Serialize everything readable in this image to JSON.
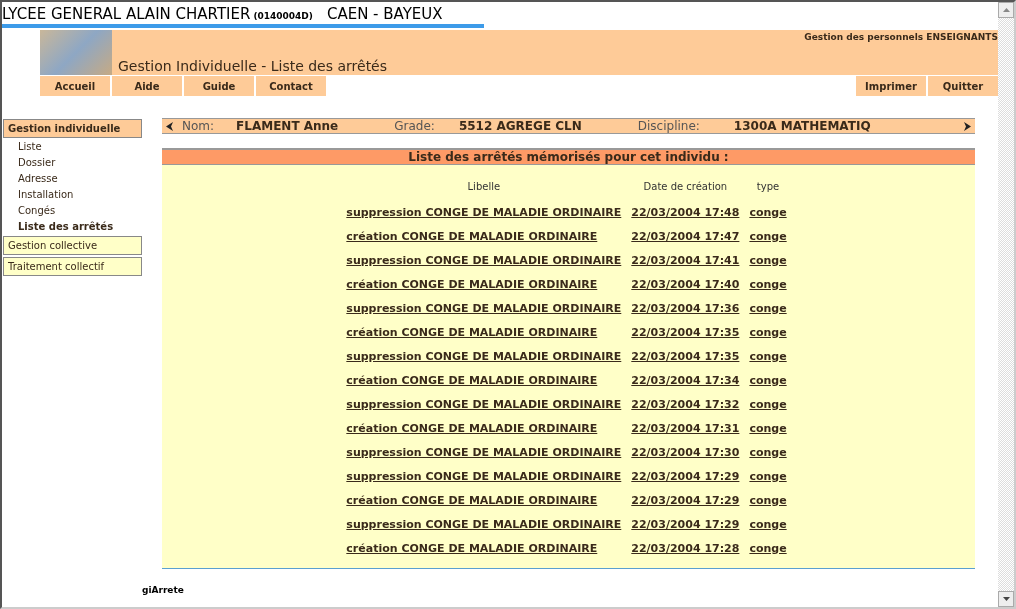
{
  "school": {
    "name": "LYCEE GENERAL ALAIN CHARTIER",
    "code": "(0140004D)",
    "city": "CAEN - BAYEUX"
  },
  "header": {
    "subtitle": "Gestion des personnels ENSEIGNANTS",
    "title": "Gestion Individuelle - Liste des arrêtés"
  },
  "nav_left": [
    "Accueil",
    "Aide",
    "Guide",
    "Contact"
  ],
  "nav_right": [
    "Imprimer",
    "Quitter"
  ],
  "sidebar": [
    {
      "label": "Gestion individuelle",
      "selected": true,
      "children": [
        {
          "label": "Liste",
          "selected": false
        },
        {
          "label": "Dossier",
          "selected": false
        },
        {
          "label": "Adresse",
          "selected": false
        },
        {
          "label": "Installation",
          "selected": false
        },
        {
          "label": "Congés",
          "selected": false
        },
        {
          "label": "Liste des arrêtés",
          "selected": true
        }
      ]
    },
    {
      "label": "Gestion collective",
      "selected": false
    },
    {
      "label": "Traitement collectif",
      "selected": false
    }
  ],
  "person": {
    "nom_label": "Nom:",
    "nom": "FLAMENT Anne",
    "grade_label": "Grade:",
    "grade": "5512 AGREGE CLN",
    "discipline_label": "Discipline:",
    "discipline": "1300A MATHEMATIQ"
  },
  "panel": {
    "title": "Liste des arrêtés mémorisés pour cet individu :",
    "columns": [
      "Libelle",
      "Date de création",
      "type"
    ],
    "rows": [
      [
        "suppression CONGE DE MALADIE ORDINAIRE",
        "22/03/2004 17:48",
        "conge"
      ],
      [
        "création CONGE DE MALADIE ORDINAIRE",
        "22/03/2004 17:47",
        "conge"
      ],
      [
        "suppression CONGE DE MALADIE ORDINAIRE",
        "22/03/2004 17:41",
        "conge"
      ],
      [
        "création CONGE DE MALADIE ORDINAIRE",
        "22/03/2004 17:40",
        "conge"
      ],
      [
        "suppression CONGE DE MALADIE ORDINAIRE",
        "22/03/2004 17:36",
        "conge"
      ],
      [
        "création CONGE DE MALADIE ORDINAIRE",
        "22/03/2004 17:35",
        "conge"
      ],
      [
        "suppression CONGE DE MALADIE ORDINAIRE",
        "22/03/2004 17:35",
        "conge"
      ],
      [
        "création CONGE DE MALADIE ORDINAIRE",
        "22/03/2004 17:34",
        "conge"
      ],
      [
        "suppression CONGE DE MALADIE ORDINAIRE",
        "22/03/2004 17:32",
        "conge"
      ],
      [
        "création CONGE DE MALADIE ORDINAIRE",
        "22/03/2004 17:31",
        "conge"
      ],
      [
        "suppression CONGE DE MALADIE ORDINAIRE",
        "22/03/2004 17:30",
        "conge"
      ],
      [
        "suppression CONGE DE MALADIE ORDINAIRE",
        "22/03/2004 17:29",
        "conge"
      ],
      [
        "création CONGE DE MALADIE ORDINAIRE",
        "22/03/2004 17:29",
        "conge"
      ],
      [
        "suppression CONGE DE MALADIE ORDINAIRE",
        "22/03/2004 17:29",
        "conge"
      ],
      [
        "création CONGE DE MALADIE ORDINAIRE",
        "22/03/2004 17:28",
        "conge"
      ]
    ]
  },
  "footer": "giArrete"
}
